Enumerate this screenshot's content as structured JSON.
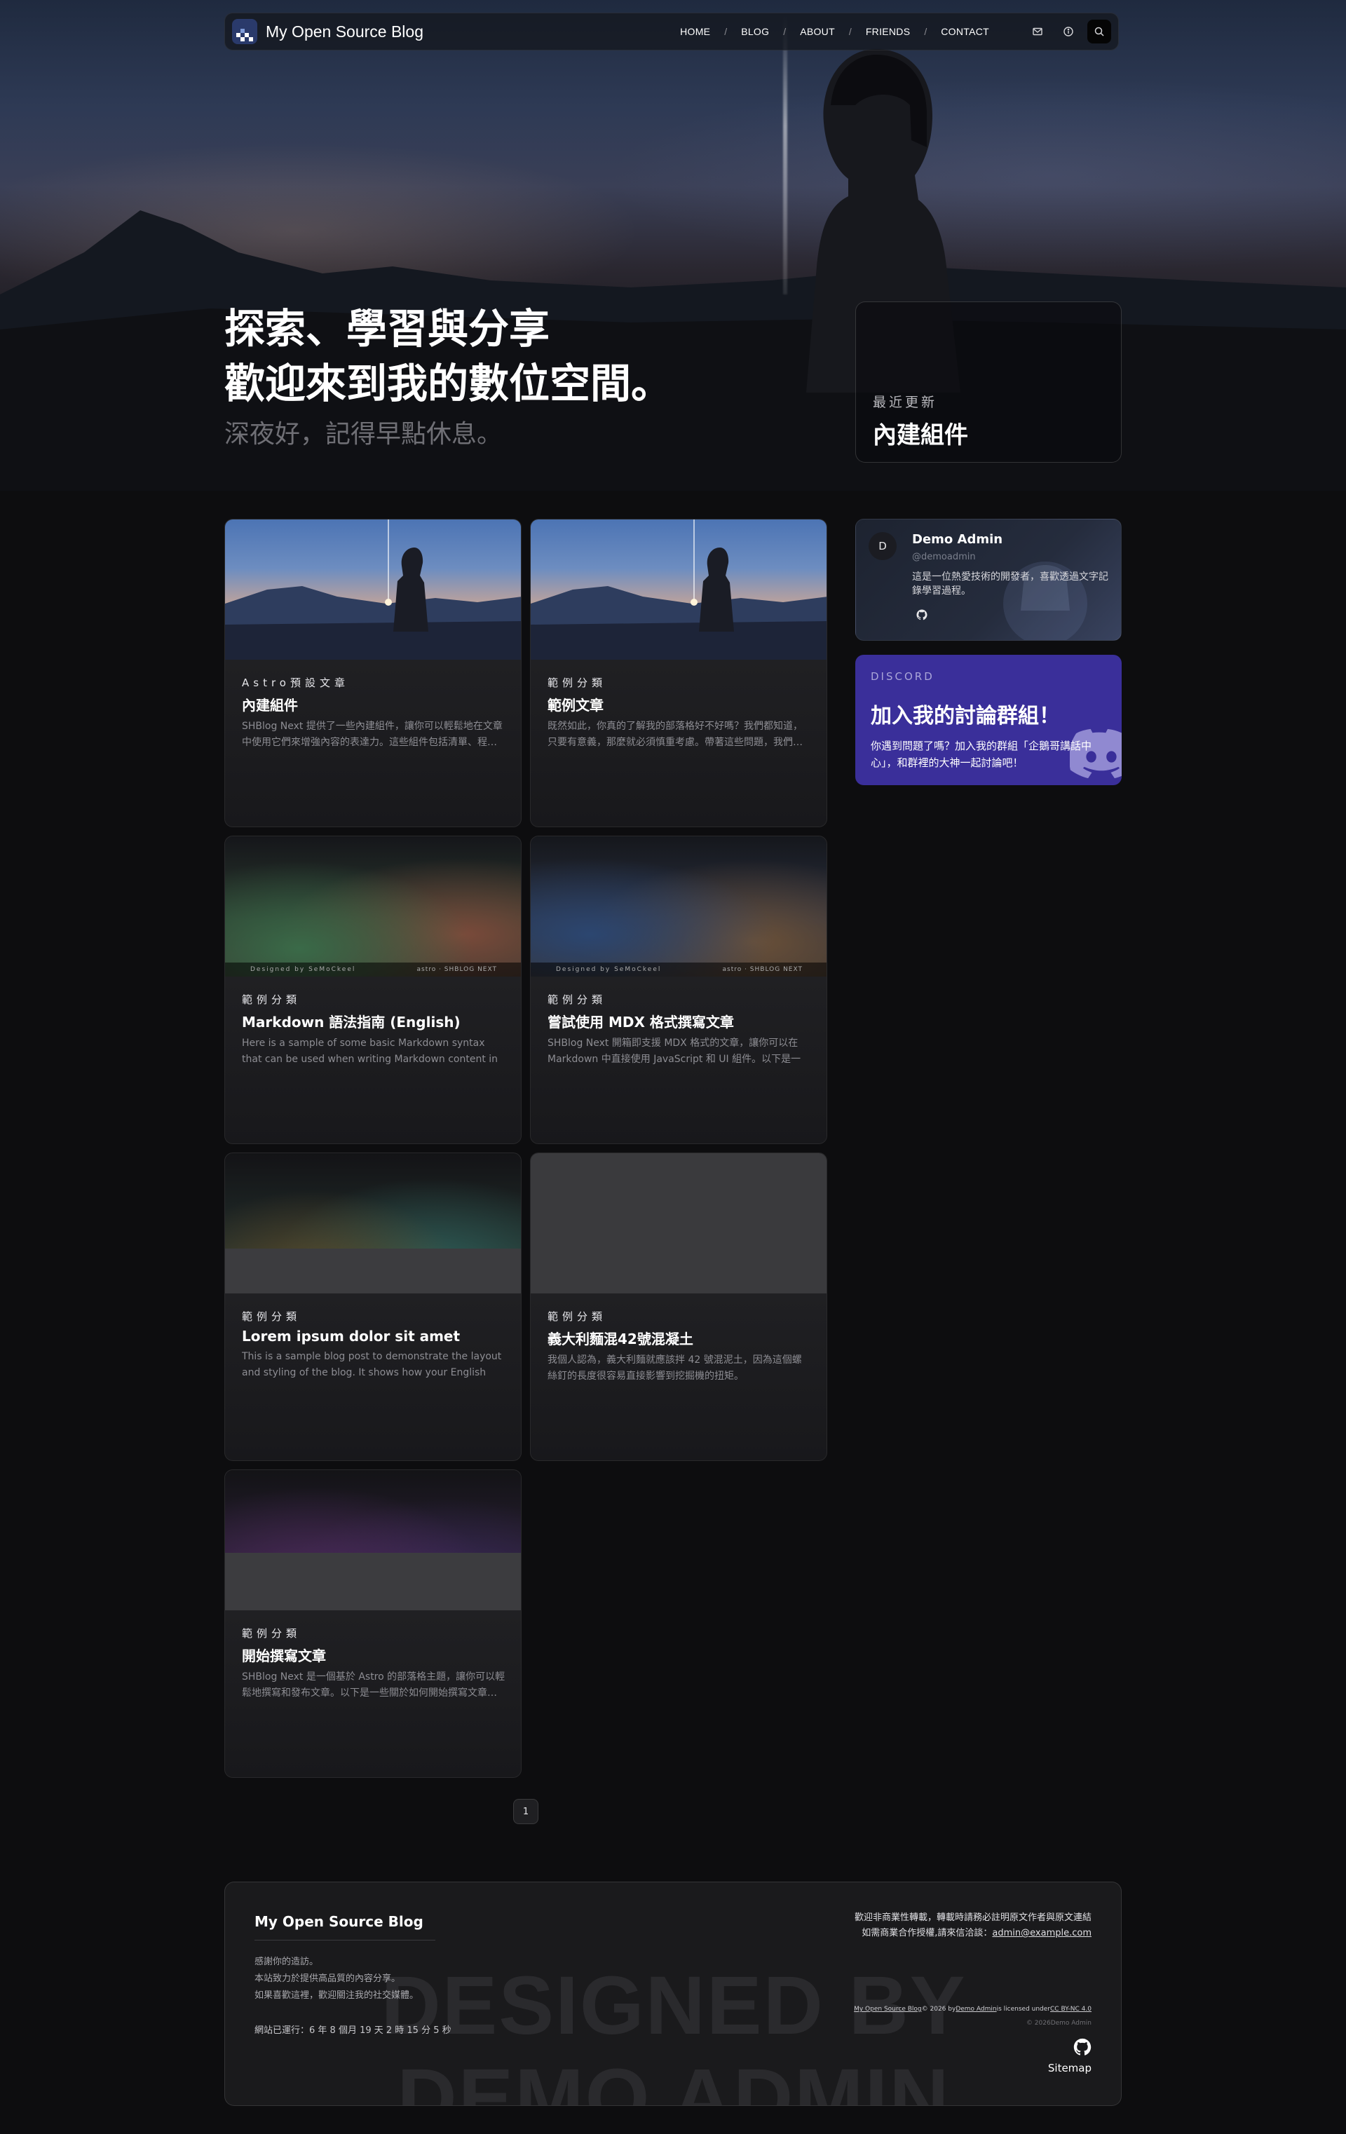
{
  "site": {
    "title": "My Open Source Blog"
  },
  "nav": {
    "links": [
      "HOME",
      "BLOG",
      "ABOUT",
      "FRIENDS",
      "CONTACT"
    ],
    "separator": "/",
    "icons": [
      "mail-icon",
      "info-icon",
      "search-icon"
    ]
  },
  "hero": {
    "line1": "探索、學習與分享",
    "line2": "歡迎來到我的數位空間。",
    "greeting": "深夜好，記得早點休息。",
    "latest_label": "最近更新",
    "latest_title": "內建組件"
  },
  "posts": [
    {
      "category": "Astro預設文章",
      "title": "內建組件",
      "excerpt": "SHBlog Next 提供了一些內建組件，讓你可以輕鬆地在文章中使用它們來增強內容的表達力。這些組件包括清單、程…",
      "cover": "anime"
    },
    {
      "category": "範例分類",
      "title": "範例文章",
      "excerpt": "既然如此，你真的了解我的部落格好不好嗎？我們都知道，只要有意義，那麼就必須慎重考慮。帶著這些問題，我們…",
      "cover": "anime"
    },
    {
      "category": "範例分類",
      "title": "Markdown 語法指南 (English)",
      "excerpt": "Here is a sample of some basic Markdown syntax that can be used when writing Markdown content in Astro.",
      "cover": "noise-green",
      "cover_left": "Designed by SeMoCkeel",
      "cover_right": "astro · SHBLOG NEXT"
    },
    {
      "category": "範例分類",
      "title": "嘗試使用 MDX 格式撰寫文章",
      "excerpt": "SHBlog Next 開箱即支援 MDX 格式的文章，讓你可以在 Markdown 中直接使用 JavaScript 和 UI 組件。以下是一些…",
      "cover": "noise-blue",
      "cover_left": "Designed by SeMoCkeel",
      "cover_right": "astro · SHBLOG NEXT"
    },
    {
      "category": "範例分類",
      "title": "Lorem ipsum dolor sit amet",
      "excerpt": "This is a sample blog post to demonstrate the layout and styling of the blog. It shows how your English content will…",
      "cover": "noise-teal"
    },
    {
      "category": "範例分類",
      "title": "義大利麵混42號混凝土",
      "excerpt": "我個人認為，義大利麵就應該拌 42 號混泥土，因為這個螺絲釘的長度很容易直接影響到挖掘機的扭矩。",
      "cover": "gray"
    },
    {
      "category": "範例分類",
      "title": "開始撰寫文章",
      "excerpt": "SHBlog Next 是一個基於 Astro 的部落格主題，讓你可以輕鬆地撰寫和發布文章。以下是一些關於如何開始撰寫文章…",
      "cover": "noise-purple"
    }
  ],
  "profile": {
    "avatar_letter": "D",
    "name": "Demo Admin",
    "handle": "@demoadmin",
    "bio": "這是一位熱愛技術的開發者，喜歡透過文字記錄學習過程。"
  },
  "discord": {
    "label": "DISCORD",
    "title": "加入我的討論群組！",
    "text": "你遇到問題了嗎？加入我的群組「企鵝哥講話中心」，和群裡的大神一起討論吧！"
  },
  "pagination": {
    "current": "1"
  },
  "footer": {
    "title": "My Open Source Blog",
    "desc1": "感謝你的造訪。",
    "desc2": "本站致力於提供高品質的內容分享。",
    "desc3": "如果喜歡這裡，歡迎關注我的社交媒體。",
    "runtime": "網站已運行：6 年 8 個月 19 天 2 時 15 分 5 秒",
    "notice1": "歡迎非商業性轉載，轉載時請務必註明原文作者與原文連結",
    "notice2_prefix": "如需商業合作授權,請來信洽談：",
    "email": "admin@example.com",
    "license_site": "My Open Source Blog",
    "license_mid1": "© 2026 by",
    "license_author": "Demo Admin",
    "license_mid2": "is licensed under",
    "license_name": "CC BY-NC 4.0",
    "copyright": "© 2026Demo Admin",
    "sitemap": "Sitemap",
    "watermark1": "DESIGNED BY",
    "watermark2": "DEMO ADMIN"
  }
}
